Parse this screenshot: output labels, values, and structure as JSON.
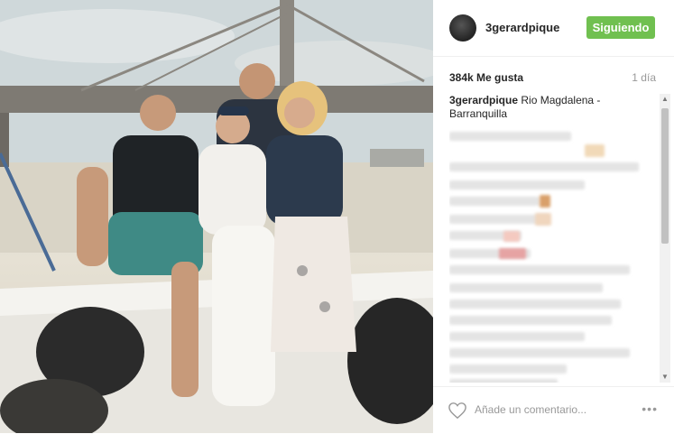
{
  "post": {
    "username": "3gerardpique",
    "follow_label": "Siguiendo",
    "likes": "384k Me gusta",
    "time": "1 día",
    "caption_user": "3gerardpique",
    "caption_text": "Rio Magdalena - Barranquilla",
    "add_comment_placeholder": "Añade un comentario...",
    "more_label": "•••"
  },
  "colors": {
    "follow_button": "#70c050",
    "text": "#262626",
    "muted": "#999999"
  },
  "icons": {
    "heart": "heart-icon",
    "more": "more-options-icon"
  }
}
